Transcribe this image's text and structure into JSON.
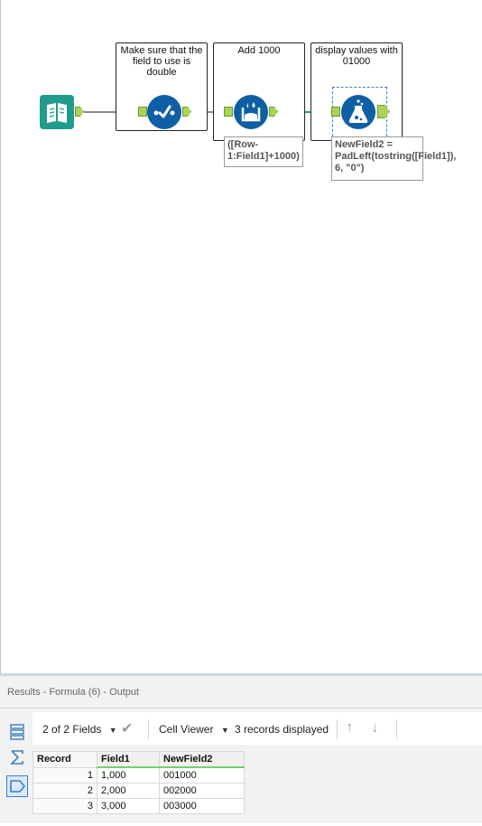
{
  "workflow": {
    "containers": [
      {
        "title": "Make sure that the field to use is double"
      },
      {
        "title": "Add 1000"
      },
      {
        "title": "display values with 01000"
      }
    ],
    "annotations": {
      "multirow": "([Row-1:Field1]+1000)",
      "formula": "NewField2 = PadLeft(tostring([Field1]), 6, \"0\")"
    },
    "tools": [
      {
        "icon": "input-data-icon"
      },
      {
        "icon": "select-icon"
      },
      {
        "icon": "multi-row-formula-icon"
      },
      {
        "icon": "formula-icon"
      }
    ]
  },
  "results": {
    "title": "Results - Formula (6) - Output",
    "fields_label": "2 of 2 Fields",
    "viewer_label": "Cell Viewer",
    "records_label": "3 records displayed",
    "columns": [
      "Record",
      "Field1",
      "NewField2"
    ],
    "rows": [
      {
        "record": "1",
        "field1": "1,000",
        "newfield2": "001000"
      },
      {
        "record": "2",
        "field1": "2,000",
        "newfield2": "002000"
      },
      {
        "record": "3",
        "field1": "3,000",
        "newfield2": "003000"
      }
    ]
  },
  "colors": {
    "tool_blue": "#0f5fa6",
    "input_teal": "#1f9c8c",
    "anchor_green": "#a9d35b",
    "wire_green": "#1fae4b"
  }
}
